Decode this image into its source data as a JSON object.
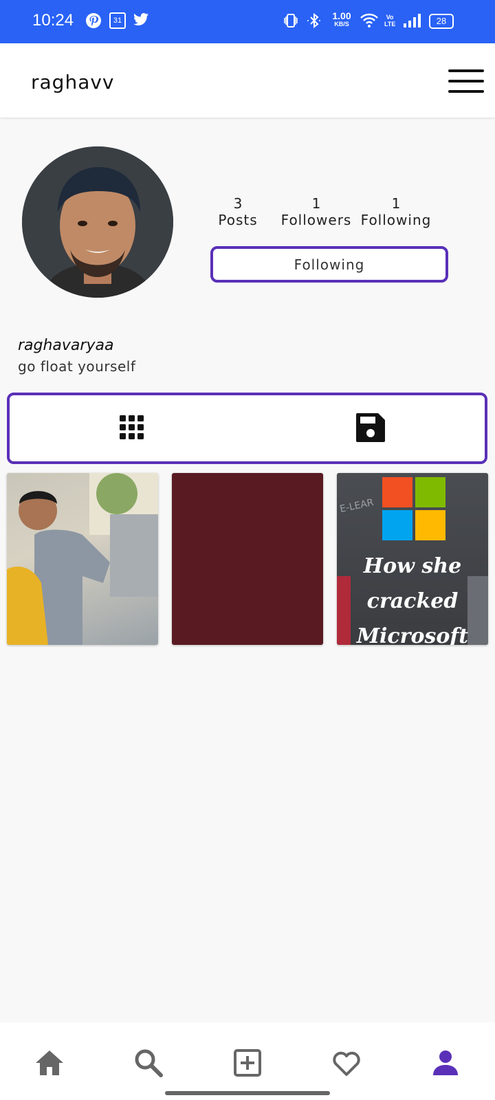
{
  "status_bar": {
    "time": "10:24",
    "notification_icons": [
      "pinterest-icon",
      "calendar-icon",
      "twitter-icon"
    ],
    "calendar_day": "31",
    "network_speed": "1.00",
    "network_speed_unit": "KB/S",
    "volte": "Vo LTE",
    "battery": "28"
  },
  "app_bar": {
    "title": "raghavv",
    "menu_icon": "hamburger-menu-icon"
  },
  "profile": {
    "stats": [
      {
        "count": "3",
        "label": "Posts"
      },
      {
        "count": "1",
        "label": "Followers"
      },
      {
        "count": "1",
        "label": "Following"
      }
    ],
    "follow_button_label": "Following",
    "username": "raghavaryaa",
    "bio": "go float yourself"
  },
  "tabs": [
    {
      "icon": "grid-icon"
    },
    {
      "icon": "save-icon"
    }
  ],
  "posts": [
    {
      "kind": "photo"
    },
    {
      "kind": "photo"
    },
    {
      "kind": "photo",
      "overlay_text": [
        "How she",
        "cracked",
        "Microsoft"
      ],
      "watermark": "E-LEAR"
    }
  ],
  "bottom_nav": [
    {
      "icon": "home-icon"
    },
    {
      "icon": "search-icon"
    },
    {
      "icon": "add-post-icon"
    },
    {
      "icon": "heart-icon"
    },
    {
      "icon": "profile-icon",
      "active": true
    }
  ],
  "colors": {
    "status_bar": "#2962f5",
    "accent": "#5a30b8",
    "nav_inactive": "#666666"
  }
}
